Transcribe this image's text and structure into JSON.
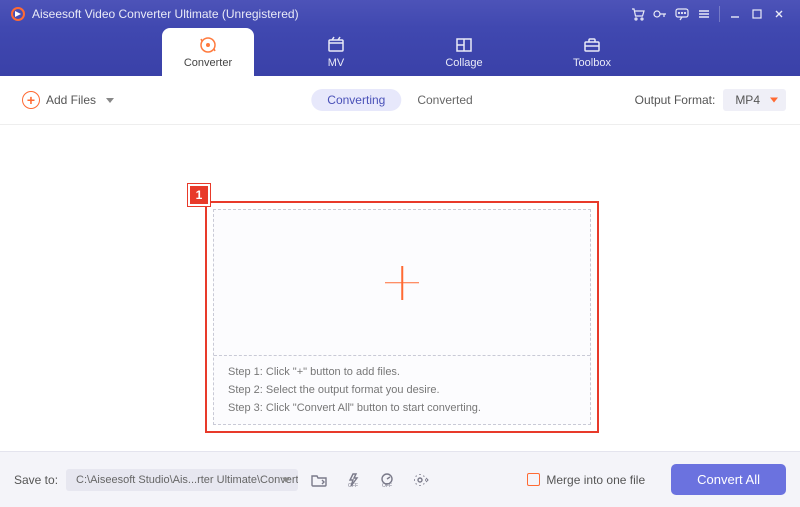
{
  "title": "Aiseesoft Video Converter Ultimate (Unregistered)",
  "ribbon": {
    "tabs": [
      {
        "label": "Converter",
        "icon": "convert-icon"
      },
      {
        "label": "MV",
        "icon": "mv-icon"
      },
      {
        "label": "Collage",
        "icon": "collage-icon"
      },
      {
        "label": "Toolbox",
        "icon": "toolbox-icon"
      }
    ]
  },
  "toolbar": {
    "add_label": "Add Files",
    "seg_converting": "Converting",
    "seg_converted": "Converted",
    "output_label": "Output Format:",
    "output_value": "MP4"
  },
  "callout": "1",
  "steps": {
    "s1": "Step 1: Click \"+\" button to add files.",
    "s2": "Step 2: Select the output format you desire.",
    "s3": "Step 3: Click \"Convert All\" button to start converting."
  },
  "bottom": {
    "save_label": "Save to:",
    "save_path": "C:\\Aiseesoft Studio\\Ais...rter Ultimate\\Converted",
    "merge_label": "Merge into one file",
    "convert_label": "Convert All"
  }
}
